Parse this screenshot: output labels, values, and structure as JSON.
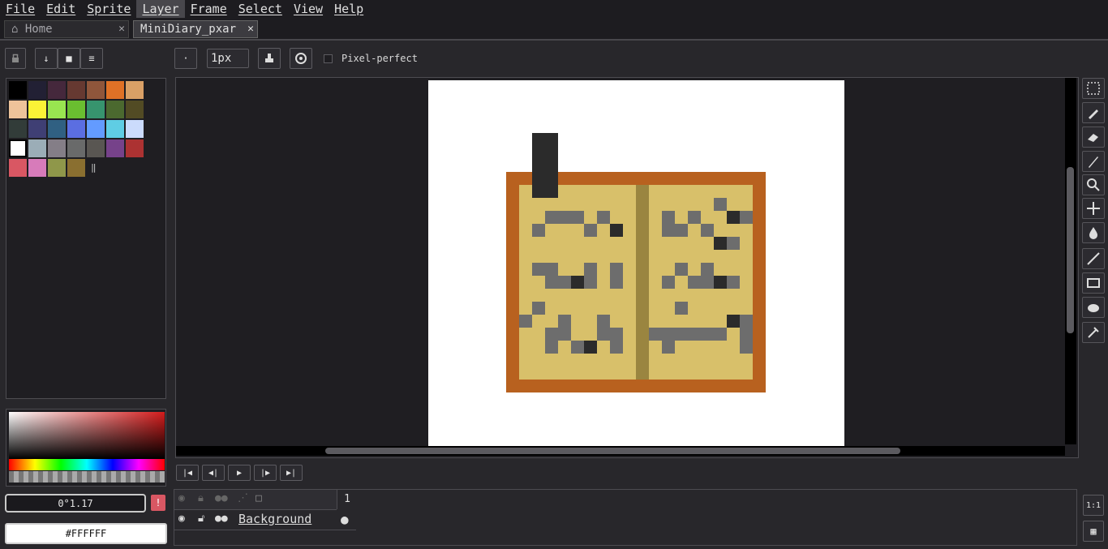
{
  "menu": [
    "File",
    "Edit",
    "Sprite",
    "Layer",
    "Frame",
    "Select",
    "View",
    "Help"
  ],
  "menu_active": "Layer",
  "tabs": {
    "home": "Home",
    "doc": "MiniDiary_pxar"
  },
  "toolbar": {
    "brush_size": "1px",
    "pixel_perfect_label": "Pixel-perfect"
  },
  "color": {
    "angle_value": "0°1.17",
    "hex_value": "#FFFFFF"
  },
  "palette": [
    "#000000",
    "#222034",
    "#45283c",
    "#663931",
    "#8f563b",
    "#df7126",
    "#d9a066",
    "#eec39a",
    "#fbf236",
    "#99e550",
    "#6abe30",
    "#37946e",
    "#4b692f",
    "#524b24",
    "#323c39",
    "#3f3f74",
    "#306082",
    "#5b6ee1",
    "#639bff",
    "#5fcde4",
    "#cbdbfc",
    "#ffffff",
    "#9badb7",
    "#847e87",
    "#696a6a",
    "#595652",
    "#76428a",
    "#ac3232",
    "#d95763",
    "#d77bba",
    "#8f974a",
    "#8a6f30"
  ],
  "timeline": {
    "frame_number": "1",
    "layer_name": "Background"
  },
  "zoom_label": "1:1",
  "icons": [
    "home-icon",
    "close-icon",
    "lock-icon",
    "arrow-down-icon",
    "square-icon",
    "menu-icon",
    "dot-icon",
    "brush-icon",
    "stamp-icon",
    "marquee-icon",
    "pencil-icon",
    "eraser-icon",
    "zoom-icon",
    "move-icon",
    "fill-icon",
    "line-icon",
    "rectangle-icon",
    "ellipse-icon",
    "spray-icon",
    "eye-icon",
    "link-icon"
  ]
}
